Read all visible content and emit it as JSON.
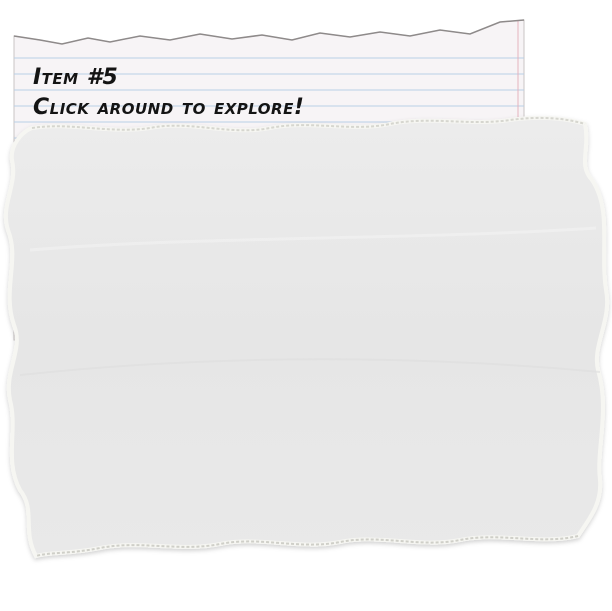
{
  "note": {
    "title": "Item #5",
    "hint": "Click around to explore!"
  },
  "colors": {
    "notebook_paper": "#f7f4f6",
    "rule_lines": "#b9cfe6",
    "margin_line": "#e5b3bf",
    "torn_paper": "#e9e9e9",
    "torn_edge": "#f6f6f2",
    "ink": "#141414"
  },
  "icons": {
    "notebook": "lined-notebook-paper",
    "scrap": "torn-paper-scrap"
  }
}
